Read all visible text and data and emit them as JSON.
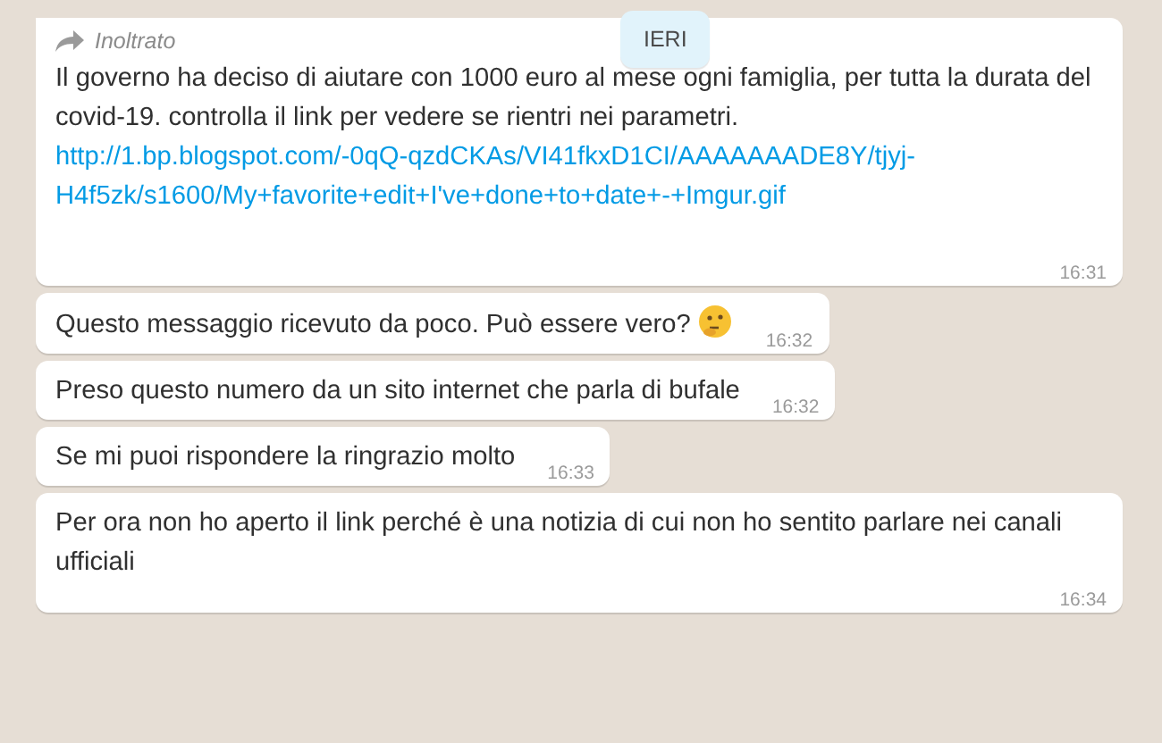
{
  "date_chip": "IERI",
  "messages": [
    {
      "forwarded_label": "Inoltrato",
      "text": "Il governo ha deciso di aiutare con 1000 euro al mese ogni famiglia, per tutta la durata del covid-19. controlla il link per vedere se rientri nei parametri.",
      "link": "http://1.bp.blogspot.com/-0qQ-qzdCKAs/VI41fkxD1CI/AAAAAAADE8Y/tjyj-H4f5zk/s1600/My+favorite+edit+I've+done+to+date+-+Imgur.gif",
      "time": "16:31"
    },
    {
      "text": "Questo messaggio ricevuto da poco. Può essere vero?",
      "emoji": true,
      "time": "16:32"
    },
    {
      "text": "Preso questo numero da un sito internet che parla di bufale",
      "time": "16:32"
    },
    {
      "text": "Se mi puoi rispondere la ringrazio molto",
      "time": "16:33"
    },
    {
      "text": "Per ora non ho aperto il link perché è una notizia di cui non ho sentito parlare nei canali ufficiali",
      "time": "16:34"
    }
  ]
}
